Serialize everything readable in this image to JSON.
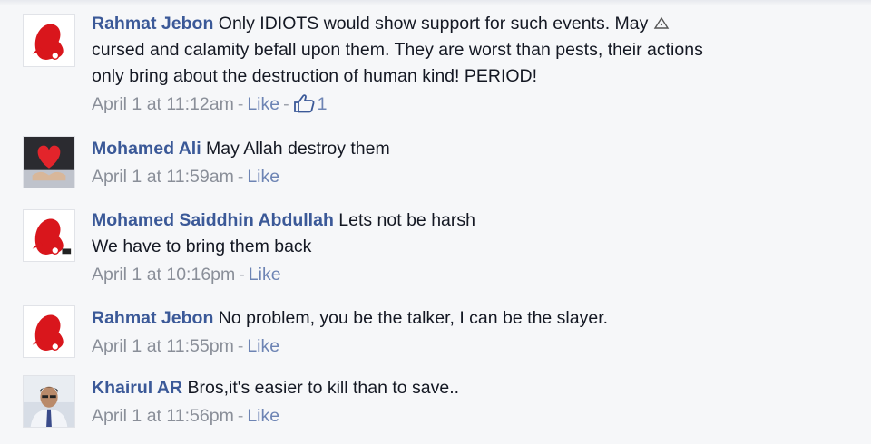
{
  "comments": [
    {
      "author": "Rahmat Jebon",
      "text": "Only IDIOTS would show support for such events. May",
      "text_lines": [
        "cursed and calamity befall upon them. They are worst than pests, their actions",
        "only bring about the destruction of human kind! PERIOD!"
      ],
      "timestamp": "April 1 at 11:12am",
      "like_label": "Like",
      "like_count": "1",
      "avatar_icon": "red-silhouette-icon"
    },
    {
      "author": "Mohamed Ali",
      "text": "May Allah destroy them",
      "timestamp": "April 1 at 11:59am",
      "like_label": "Like",
      "avatar_icon": "heart-hands-icon"
    },
    {
      "author": "Mohamed Saiddhin Abdullah",
      "text": "Lets not be harsh",
      "text_lines": [
        "We have to bring them back"
      ],
      "timestamp": "April 1 at 10:16pm",
      "like_label": "Like",
      "avatar_icon": "red-silhouette-icon"
    },
    {
      "author": "Rahmat Jebon",
      "text": "No problem, you be the talker, I can be the slayer.",
      "timestamp": "April 1 at 11:55pm",
      "like_label": "Like",
      "avatar_icon": "red-silhouette-icon"
    },
    {
      "author": "Khairul AR",
      "text": "Bros,it's easier to kill than to save..",
      "timestamp": "April 1 at 11:56pm",
      "like_label": "Like",
      "avatar_icon": "person-photo-icon"
    }
  ],
  "colors": {
    "author": "#3b5998",
    "meta": "#8a8f99",
    "like": "#6d84b4",
    "background": "#f6f7f9"
  }
}
